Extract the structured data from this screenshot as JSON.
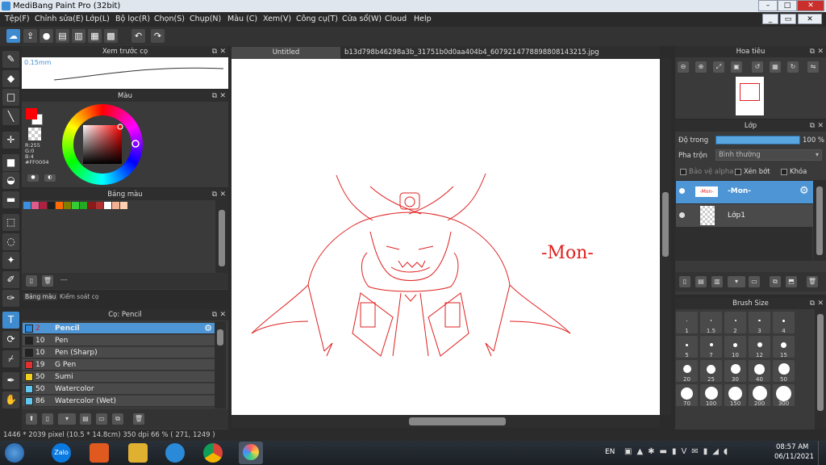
{
  "window": {
    "title": "MediBang Paint Pro (32bit)",
    "min": "–",
    "max": "□",
    "close": "✕",
    "inner_min": "_",
    "inner_restore": "▭",
    "inner_close": "✕"
  },
  "menu": [
    {
      "label": "Tệp(F)"
    },
    {
      "label": "Chỉnh sửa(E)"
    },
    {
      "label": "Lớp(L)"
    },
    {
      "label": "Bộ lọc(R)"
    },
    {
      "label": "Chọn(S)"
    },
    {
      "label": "Chụp(N)"
    },
    {
      "label": "Màu (C)"
    },
    {
      "label": "Xem(V)"
    },
    {
      "label": "Công cụ(T)"
    },
    {
      "label": "Cửa sổ(W)"
    },
    {
      "label": "Cloud"
    },
    {
      "label": "Help"
    }
  ],
  "panels": {
    "brush_preview": {
      "title": "Xem trước cọ",
      "size": "0.15mm"
    },
    "color": {
      "title": "Màu",
      "r": "R:255",
      "g": "G:0",
      "b": "B:4",
      "hex": "#FF0004"
    },
    "palette": {
      "title": "Bảng màu",
      "dash": "---",
      "tab1": "Bảng màu",
      "tab2": "Kiểm soát cọ",
      "swatches": [
        "#3a8fe0",
        "#e05a8a",
        "#b02040",
        "#202020",
        "#ff6a00",
        "#808000",
        "#33cc33",
        "#22aa22",
        "#8b1a1a",
        "#b03030",
        "#ffffff",
        "#f4b090",
        "#ffd0b0"
      ]
    },
    "brush": {
      "title": "Cọ: Pencil"
    },
    "navigator": {
      "title": "Hoa tiêu"
    },
    "layer": {
      "title": "Lớp",
      "opacity_label": "Độ trong",
      "opacity_value": "100 %",
      "blend_label": "Pha trộn",
      "blend_value": "Bình thường",
      "protect_alpha": "Bảo vệ alpha",
      "clipping": "Xén bớt",
      "lock": "Khóa"
    },
    "brush_size": {
      "title": "Brush Size"
    }
  },
  "brushes": [
    {
      "size": "2",
      "name": "Pencil",
      "color": "#2e8be0",
      "selected": true
    },
    {
      "size": "10",
      "name": "Pen",
      "color": "#222222"
    },
    {
      "size": "10",
      "name": "Pen (Sharp)",
      "color": "#222222"
    },
    {
      "size": "19",
      "name": "G Pen",
      "color": "#e03030"
    },
    {
      "size": "50",
      "name": "Sumi",
      "color": "#f0d020"
    },
    {
      "size": "50",
      "name": "Watercolor",
      "color": "#60c8f0"
    },
    {
      "size": "86",
      "name": "Watercolor (Wet)",
      "color": "#60c8f0"
    }
  ],
  "brush_sizes": [
    "1",
    "1.5",
    "2",
    "3",
    "4",
    "5",
    "7",
    "10",
    "12",
    "15",
    "20",
    "25",
    "30",
    "40",
    "50",
    "70",
    "100",
    "150",
    "200",
    "300"
  ],
  "layers": [
    {
      "name": "-Mon-",
      "thumb_text": "-Mon-",
      "selected": true
    },
    {
      "name": "Lớp1",
      "selected": false
    }
  ],
  "tabs": [
    {
      "label": "Untitled"
    },
    {
      "label": "b13d798b46298a3b_31751b0d0aa404b4_6079214778898808143215.jpg"
    }
  ],
  "artwork": {
    "text": "-Mon-",
    "color": "#e02020"
  },
  "status": {
    "text": "1446 * 2039 pixel   (10.5 * 14.8cm)   350 dpi   66 %   ( 271, 1249 )"
  },
  "taskbar": {
    "lang": "EN",
    "time": "08:57 AM",
    "date": "06/11/2021",
    "zalo": "Zalo"
  }
}
